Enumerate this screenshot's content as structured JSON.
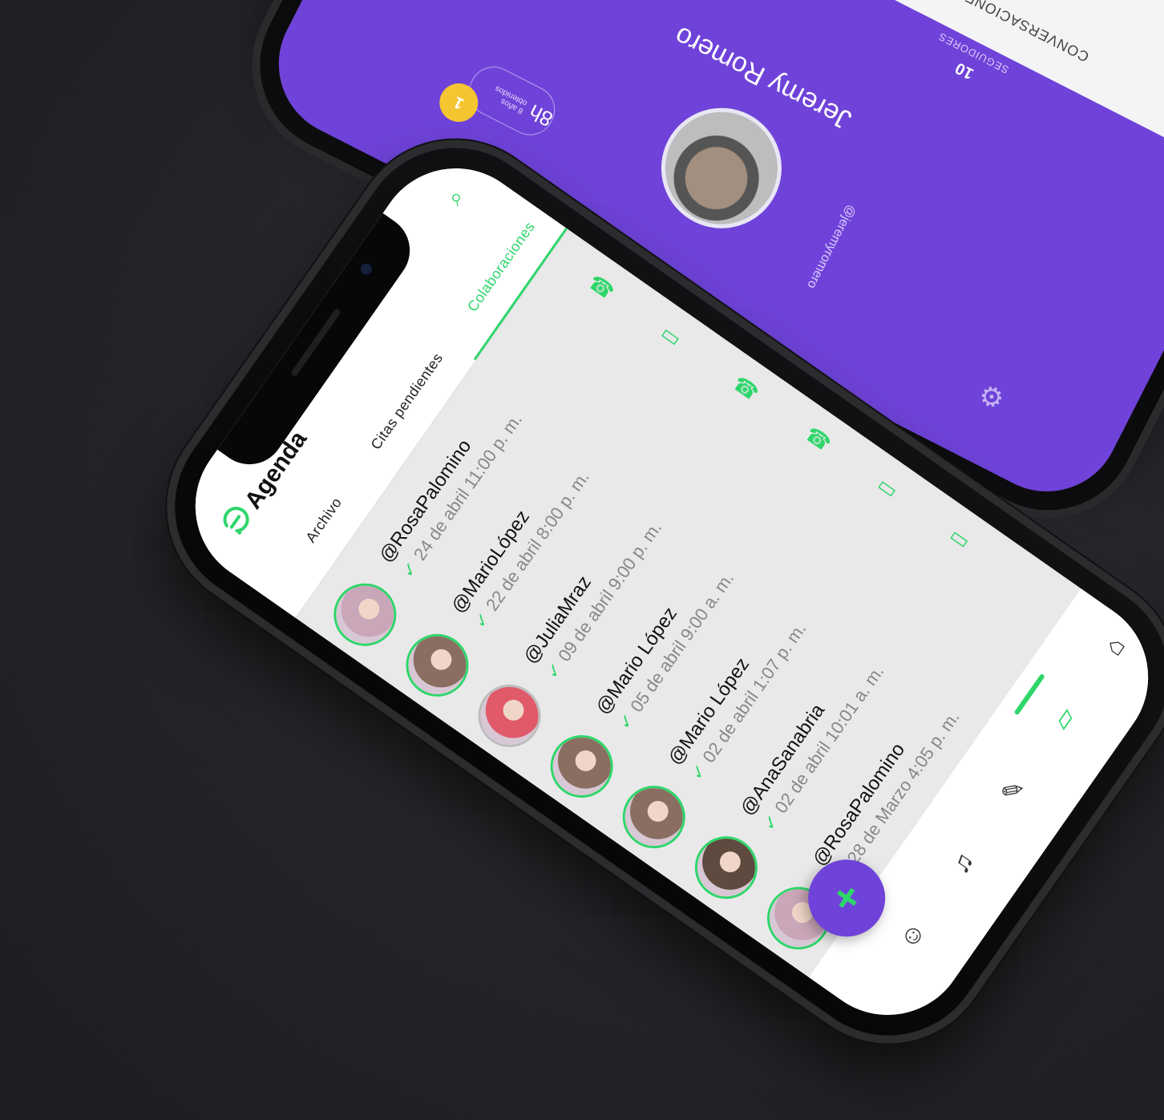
{
  "back_phone": {
    "name": "Jeremy Romero",
    "handle": "@jeremyromero",
    "stat_value": "10",
    "stat_label": "SEGUIDORES",
    "tab_label": "CONVERSACIONES",
    "badge_value": "8h",
    "badge_sub": "8 años obtenidos",
    "coin_value": "1",
    "icons": {
      "settings": "gear-icon"
    }
  },
  "header": {
    "title": "Agenda",
    "tabs": [
      {
        "label": "Archivo",
        "active": false
      },
      {
        "label": "Citas pendientes",
        "active": false
      },
      {
        "label": "Colaboraciones",
        "active": true
      }
    ],
    "icons": {
      "logo": "app-logo",
      "search": "search-icon",
      "more": "more-dots-icon"
    }
  },
  "appointments": [
    {
      "handle": "@RosaPalomino",
      "date": "24 de abril 11:00 p. m.",
      "type": "call",
      "avatar_border": "green",
      "avatar_color": "#c9a6b8"
    },
    {
      "handle": "@MarioLópez",
      "date": "22 de abril 8:00 p. m.",
      "type": "video",
      "avatar_border": "green",
      "avatar_color": "#8a6e62"
    },
    {
      "handle": "@JuliaMraz",
      "date": "09 de abril 9:00 p. m.",
      "type": "call",
      "avatar_border": "gray",
      "avatar_color": "#e05a6a"
    },
    {
      "handle": "@Mario López",
      "date": "05 de abril 9:00 a. m.",
      "type": "call",
      "avatar_border": "green",
      "avatar_color": "#8a6e62"
    },
    {
      "handle": "@Mario López",
      "date": "02 de abril 1:07 p. m.",
      "type": "video",
      "avatar_border": "green",
      "avatar_color": "#8a6e62"
    },
    {
      "handle": "@AnaSanabria",
      "date": "02 de abril 10:01 a. m.",
      "type": "video",
      "avatar_border": "green",
      "avatar_color": "#5e4a3e"
    },
    {
      "handle": "@RosaPalomino",
      "date": "28 de Marzo 4:05 p. m.",
      "type": "none",
      "avatar_border": "green",
      "avatar_color": "#c9a6b8"
    }
  ],
  "navbar": {
    "items": [
      {
        "icon": "home-icon",
        "active": false
      },
      {
        "icon": "agenda-icon",
        "active": true
      },
      {
        "icon": "pencil-icon",
        "active": false
      },
      {
        "icon": "bell-icon",
        "active": false
      },
      {
        "icon": "people-icon",
        "active": false
      }
    ]
  },
  "fab": {
    "label": "+"
  },
  "colors": {
    "accent": "#2ed66a",
    "brand": "#6f43d9",
    "screen_bg": "#e9e9ea"
  }
}
